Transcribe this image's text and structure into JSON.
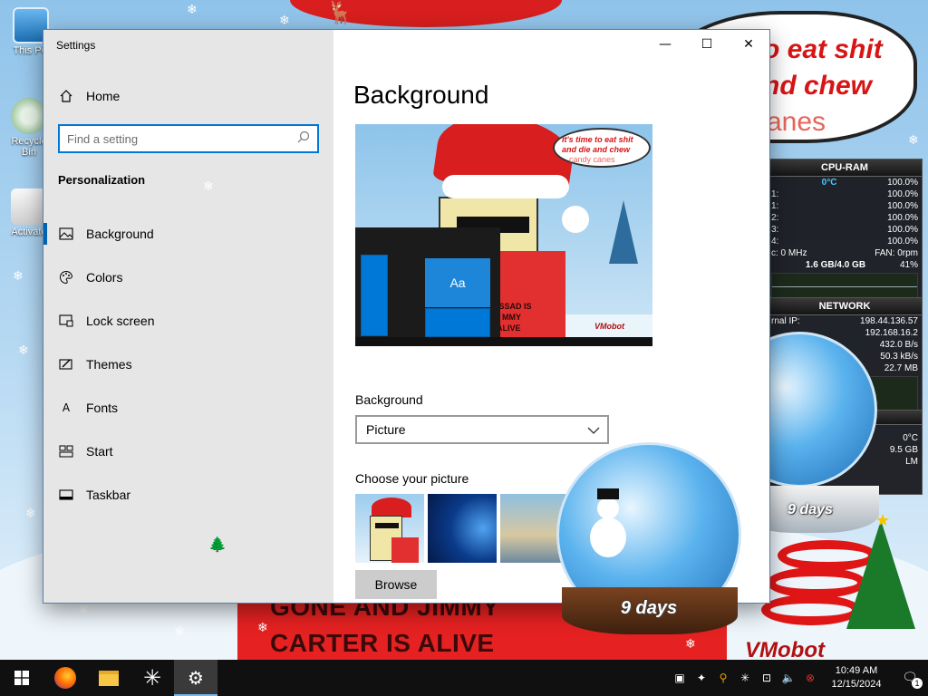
{
  "desktop": {
    "icons": [
      {
        "label": "This PC"
      },
      {
        "label": "Recycle Bin"
      },
      {
        "label": "Activate"
      }
    ],
    "speech_bubble": {
      "line1": "o eat shit",
      "line2": "nd chew",
      "line3": "anes"
    },
    "banner": {
      "line1": "GONE AND JIMMY",
      "line2": "CARTER IS ALIVE"
    },
    "watermark": "VMobot"
  },
  "gadgets": {
    "cpu": {
      "title": "CPU-RAM",
      "temp": "0°C",
      "total": "100.0%",
      "cores": [
        {
          "label": "1:",
          "value": "100.0%"
        },
        {
          "label": "1:",
          "value": "100.0%"
        },
        {
          "label": "2:",
          "value": "100.0%"
        },
        {
          "label": "3:",
          "value": "100.0%"
        },
        {
          "label": "4:",
          "value": "100.0%"
        }
      ],
      "clock": "c: 0 MHz",
      "fan": "FAN: 0rpm",
      "ram": "1.6 GB/4.0 GB",
      "ram_pct": "41%"
    },
    "network": {
      "title": "NETWORK",
      "internal_ip_label": "rnal IP:",
      "internal_ip": "198.44.136.57",
      "local_ip": "192.168.16.2",
      "rate1": "432.0 B/s",
      "rate2": "50.3 kB/s",
      "rate3": "22.7 MB"
    },
    "drive": {
      "temp": "0°C",
      "size": "9.5 GB",
      "label": "LM"
    }
  },
  "globes": {
    "left_days": "9 days",
    "right_days": "9 days"
  },
  "settings": {
    "window_title": "Settings",
    "controls": {
      "minimize": "—",
      "maximize": "☐",
      "close": "✕"
    },
    "home_label": "Home",
    "search": {
      "placeholder": "Find a setting"
    },
    "section_label": "Personalization",
    "nav_items": [
      {
        "label": "Background",
        "icon": "picture-icon",
        "active": true
      },
      {
        "label": "Colors",
        "icon": "palette-icon",
        "active": false
      },
      {
        "label": "Lock screen",
        "icon": "lock-screen-icon",
        "active": false
      },
      {
        "label": "Themes",
        "icon": "brush-icon",
        "active": false
      },
      {
        "label": "Fonts",
        "icon": "font-icon",
        "active": false
      },
      {
        "label": "Start",
        "icon": "start-icon",
        "active": false
      },
      {
        "label": "Taskbar",
        "icon": "taskbar-icon",
        "active": false
      }
    ],
    "page_title": "Background",
    "preview": {
      "bubble_line1": "It's time to eat shit",
      "bubble_line2": "and die and chew",
      "bubble_line3": "candy canes",
      "shirt_line1": "ASSAD IS",
      "shirt_line2": "MMY",
      "shirt_line3": "ALIVE",
      "tile_text": "Aa",
      "watermark": "VMobot"
    },
    "background_label": "Background",
    "background_value": "Picture",
    "choose_label": "Choose your picture",
    "browse_label": "Browse"
  },
  "taskbar": {
    "time": "10:49 AM",
    "date": "12/15/2024",
    "notification_count": "1"
  },
  "colors": {
    "accent": "#0078d7",
    "sidebar_bg": "#e6e6e6",
    "taskbar_bg": "#101010"
  }
}
